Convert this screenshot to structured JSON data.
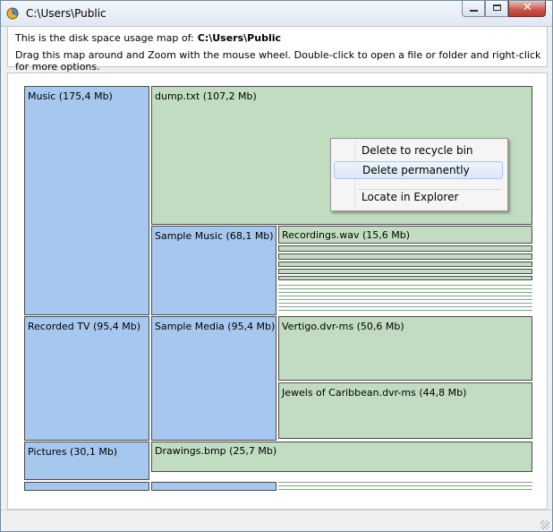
{
  "window": {
    "title": "C:\\Users\\Public",
    "colors": {
      "folder": "#a6c8ee",
      "file": "#c1dcc1",
      "border": "#4c4c4c"
    }
  },
  "info": {
    "intro": "This is the disk space usage map of:",
    "path": "C:\\Users\\Public",
    "instructions": "Drag this map around and Zoom with the mouse wheel. Double-click to open a file or folder and right-click for more options."
  },
  "map": {
    "folders": [
      {
        "name": "Music",
        "size": "Music (175,4 Mb)"
      },
      {
        "name": "Sample Music",
        "size": "Sample Music (68,1 Mb)"
      },
      {
        "name": "Recorded TV",
        "size": "Recorded TV (95,4 Mb)"
      },
      {
        "name": "Sample Media",
        "size": "Sample Media (95,4 Mb)"
      },
      {
        "name": "Pictures",
        "size": "Pictures (30,1 Mb)"
      }
    ],
    "files": [
      {
        "name": "dump.txt",
        "size": "dump.txt (107,2 Mb)"
      },
      {
        "name": "Recordings.wav",
        "size": "Recordings.wav (15,6 Mb)"
      },
      {
        "name": "Vertigo.dvr-ms",
        "size": "Vertigo.dvr-ms (50,6 Mb)"
      },
      {
        "name": "Jewels of Caribbean.dvr-ms",
        "size": "Jewels of Caribbean.dvr-ms (44,8 Mb)"
      },
      {
        "name": "Drawings.bmp",
        "size": "Drawings.bmp (25,7 Mb)"
      }
    ]
  },
  "context_menu": {
    "items": [
      {
        "label": "Delete to recycle bin",
        "highlighted": false
      },
      {
        "label": "Delete permanently",
        "highlighted": true
      },
      {
        "label": "Locate in Explorer",
        "highlighted": false
      }
    ]
  },
  "icons": {
    "app": "pie-chart-icon",
    "minimize": "minimize-icon",
    "maximize": "maximize-icon",
    "close": "close-icon"
  }
}
